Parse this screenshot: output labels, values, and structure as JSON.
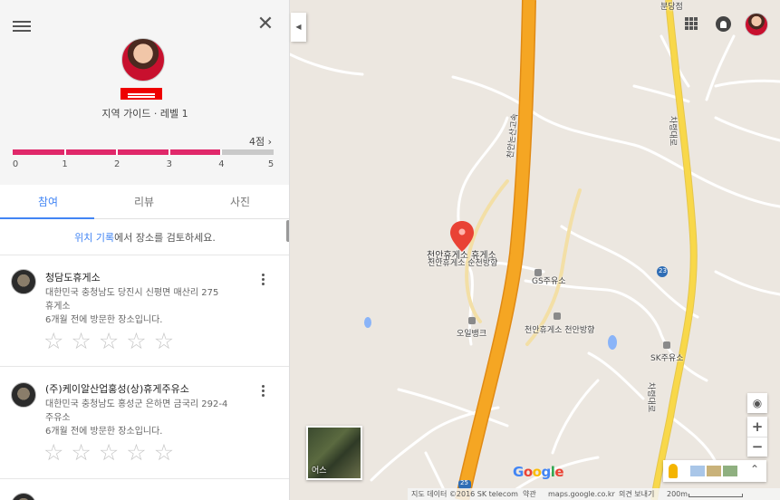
{
  "profile": {
    "subtitle": "지역 가이드 · 레벨 1",
    "points": "4점 ›",
    "progress_fraction": 0.8,
    "tick_labels": [
      "0",
      "1",
      "2",
      "3",
      "4",
      "5"
    ]
  },
  "tabs": [
    {
      "label": "참여",
      "active": true
    },
    {
      "label": "리뷰",
      "active": false
    },
    {
      "label": "사진",
      "active": false
    }
  ],
  "hint": {
    "link": "위치 기록",
    "text": "에서 장소를 검토하세요."
  },
  "places": [
    {
      "name": "청담도휴게소",
      "address": "대한민국 충청남도 당진시 신평면 매산리 275",
      "category": "휴게소",
      "visited": "6개월 전에 방문한 장소입니다."
    },
    {
      "name": "(주)케이알산업홍성(상)휴게주유소",
      "address": "대한민국 충청남도 홍성군 은하면 금국리 292-4",
      "category": "주유소",
      "visited": "6개월 전에 방문한 장소입니다."
    }
  ],
  "star_glyph": "☆",
  "icons": {
    "close": "✕",
    "collapse": "◀",
    "zoom_in": "+",
    "zoom_out": "−",
    "expand": "⌃"
  },
  "map": {
    "labels": {
      "selected_place": "천안휴게소 휴게소",
      "selected_sub": "천안휴게소 순천방향",
      "highway": "천안논산고속",
      "gas_station": "GS주유소",
      "bank": "오일뱅크",
      "rest_area": "천안휴게소 천안방향",
      "sk_station": "SK주유소",
      "road_vertical": "차령대로",
      "road_vertical2": "차령대로",
      "top_right": "분당점",
      "road_num": "23",
      "highway_num": "25"
    },
    "satellite_label": "어스",
    "footer": {
      "data": "지도 데이터 ©2016 SK telecom",
      "terms": "약관",
      "site": "maps.google.co.kr",
      "feedback": "의견 보내기",
      "scale": "200m"
    },
    "logo": [
      "G",
      "o",
      "o",
      "g",
      "l",
      "e"
    ],
    "logo_colors": [
      "#4285f4",
      "#ea4335",
      "#fbbc05",
      "#4285f4",
      "#34a853",
      "#ea4335"
    ],
    "accent_pink": "#e0286a",
    "accent_blue": "#4285f4",
    "highway_color": "#f5a623",
    "road_color": "#f8d84a"
  }
}
